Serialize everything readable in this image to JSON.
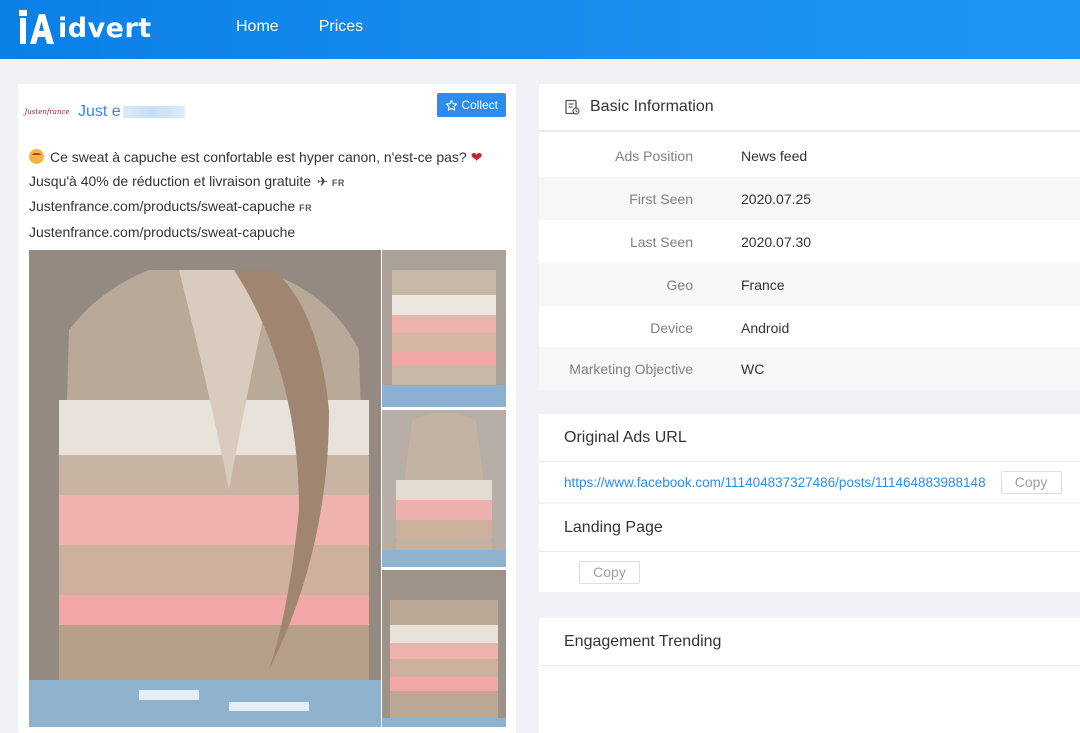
{
  "header": {
    "logo_text": "idvert",
    "nav": [
      {
        "label": "Home"
      },
      {
        "label": "Prices"
      }
    ]
  },
  "ad": {
    "advertiser_name": "Just e",
    "advertiser_logo_text": "Justenfrance",
    "collect_label": "Collect",
    "text_line1": "Ce sweat à capuche est confortable est hyper canon, n'est-ce pas?",
    "text_line2": "Jusqu'à 40% de réduction et livraison gratuite",
    "text_line3": "Justenfrance.com/products/sweat-capuche",
    "text_line4": "Justenfrance.com/products/sweat-capuche",
    "lang_tag": "FR"
  },
  "basic_info": {
    "title": "Basic Information",
    "rows": [
      {
        "label": "Ads Position",
        "value": "News feed"
      },
      {
        "label": "First Seen",
        "value": "2020.07.25"
      },
      {
        "label": "Last Seen",
        "value": "2020.07.30"
      },
      {
        "label": "Geo",
        "value": "France"
      },
      {
        "label": "Device",
        "value": "Android"
      },
      {
        "label": "Marketing Objective",
        "value": "WC"
      }
    ]
  },
  "original_url": {
    "title": "Original Ads URL",
    "url": "https://www.facebook.com/111404837327486/posts/111464883988148",
    "copy_label": "Copy"
  },
  "landing_page": {
    "title": "Landing Page",
    "copy_label": "Copy"
  },
  "engagement": {
    "title": "Engagement Trending"
  },
  "colors": {
    "brand_blue": "#1b8ff0",
    "link_blue": "#2d8cf0"
  }
}
